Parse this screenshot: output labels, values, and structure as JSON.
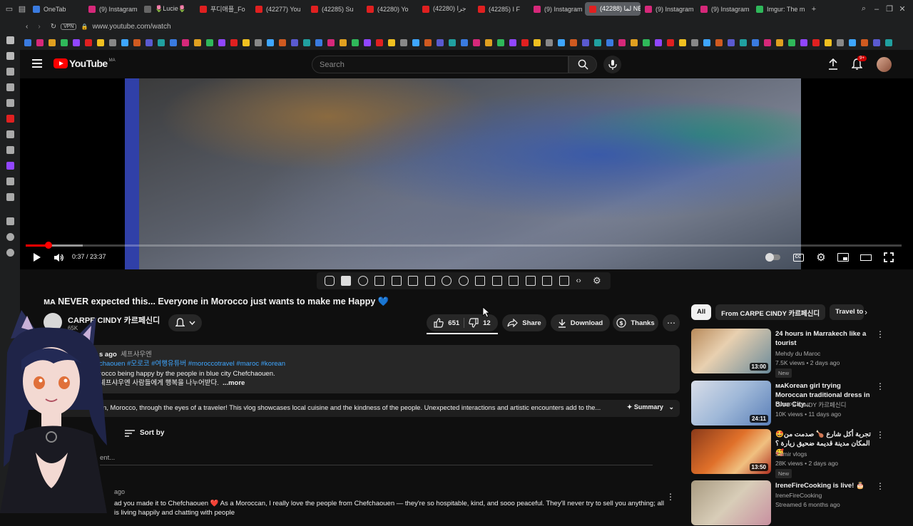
{
  "browser": {
    "tabs": [
      {
        "label": "OneTab",
        "color": "#3a7be0"
      },
      {
        "label": "(9) Instagram",
        "color": "#d6287a"
      },
      {
        "label": "🌷Lucie🌷",
        "color": "#666666"
      },
      {
        "label": "푸디애플_Fo",
        "color": "#e02020"
      },
      {
        "label": "(42277) You",
        "color": "#e02020"
      },
      {
        "label": "(42285) Su",
        "color": "#e02020"
      },
      {
        "label": "(42280) Yo",
        "color": "#e02020"
      },
      {
        "label": "(42280) جرا",
        "color": "#e02020"
      },
      {
        "label": "(42285) I F",
        "color": "#e02020"
      },
      {
        "label": "(9) Instagram",
        "color": "#d6287a"
      },
      {
        "label": "(42288) لما NEVE",
        "color": "#e02020",
        "active": true
      },
      {
        "label": "(9) Instagram",
        "color": "#d6287a"
      },
      {
        "label": "(9) Instagram",
        "color": "#d6287a"
      },
      {
        "label": "Imgur: The m",
        "color": "#2fb85a"
      }
    ],
    "new_tab": "+",
    "vpn": "VPN",
    "url": "www.youtube.com/watch"
  },
  "header": {
    "logo": "YouTube",
    "region": "MA",
    "search_placeholder": "Search",
    "notif_count": "9+"
  },
  "player": {
    "time": "0:37 / 23:37",
    "progress": 0.026,
    "buffered": 0.065
  },
  "video": {
    "title": "ᴍᴀ NEVER expected this... Everyone in Morocco just wants to make me Happy 💙",
    "channel": "CARPE CINDY 카르페신디",
    "subs": "65K",
    "likes": "651",
    "dislikes": "12",
    "share": "Share",
    "download": "Download",
    "thanks": "Thanks",
    "desc_views": "s ago",
    "desc_place": "셰프샤우엔",
    "desc_tags": "chaouen #모로코 #여행유튜버 #moroccotravel #maroc #korean",
    "desc_line1": "rocco being happy by the people in blue city Chefchaouen.",
    "desc_line2": "셰프샤우엔 사람들에게 행복을 나누어받다.",
    "desc_more": "...more",
    "summary_text": "en, Morocco, through the eyes of a traveler! This vlog showcases local cuisine and the kindness of the people. Unexpected interactions and artistic encounters add to the...",
    "summary_btn": "Summary"
  },
  "comments": {
    "sort_label": "Sort by",
    "add_placeholder": "ent...",
    "first_meta": "ago",
    "first_text": "ad you made it to Chefchaouen ❤️ As a Moroccan, I really love the people from Chefchaouen — they're so hospitable, kind, and sooo peaceful. They'll never try to sell you anything; all",
    "first_text2": "is living happily and chatting with people"
  },
  "chips": [
    "All",
    "From CARPE CINDY 카르페신디",
    "Travel to"
  ],
  "recommendations": [
    {
      "title": "24 hours in Marrakech like a tourist",
      "channel": "Mehdy du Maroc",
      "meta": "7.5K views • 2 days ago",
      "duration": "13:00",
      "badge": "New"
    },
    {
      "title": "ᴍᴀKorean girl trying Moroccan traditional dress in Blue City...",
      "channel": "CARPE CINDY 카르페신디",
      "meta": "10K views • 11 days ago",
      "duration": "24:11",
      "badge": ""
    },
    {
      "title": "🤩تجربة أكل شارع 🍗 صدمت من المكان مدينة قديمة ضحيق زيارة ؟ 🥰",
      "channel": "Samir vlogs",
      "meta": "28K views • 2 days ago",
      "duration": "13:50",
      "badge": "New"
    },
    {
      "title": "IreneFireCooking is live! 🎂",
      "channel": "IreneFireCooking",
      "meta": "Streamed 6 months ago",
      "duration": "",
      "badge": ""
    }
  ]
}
